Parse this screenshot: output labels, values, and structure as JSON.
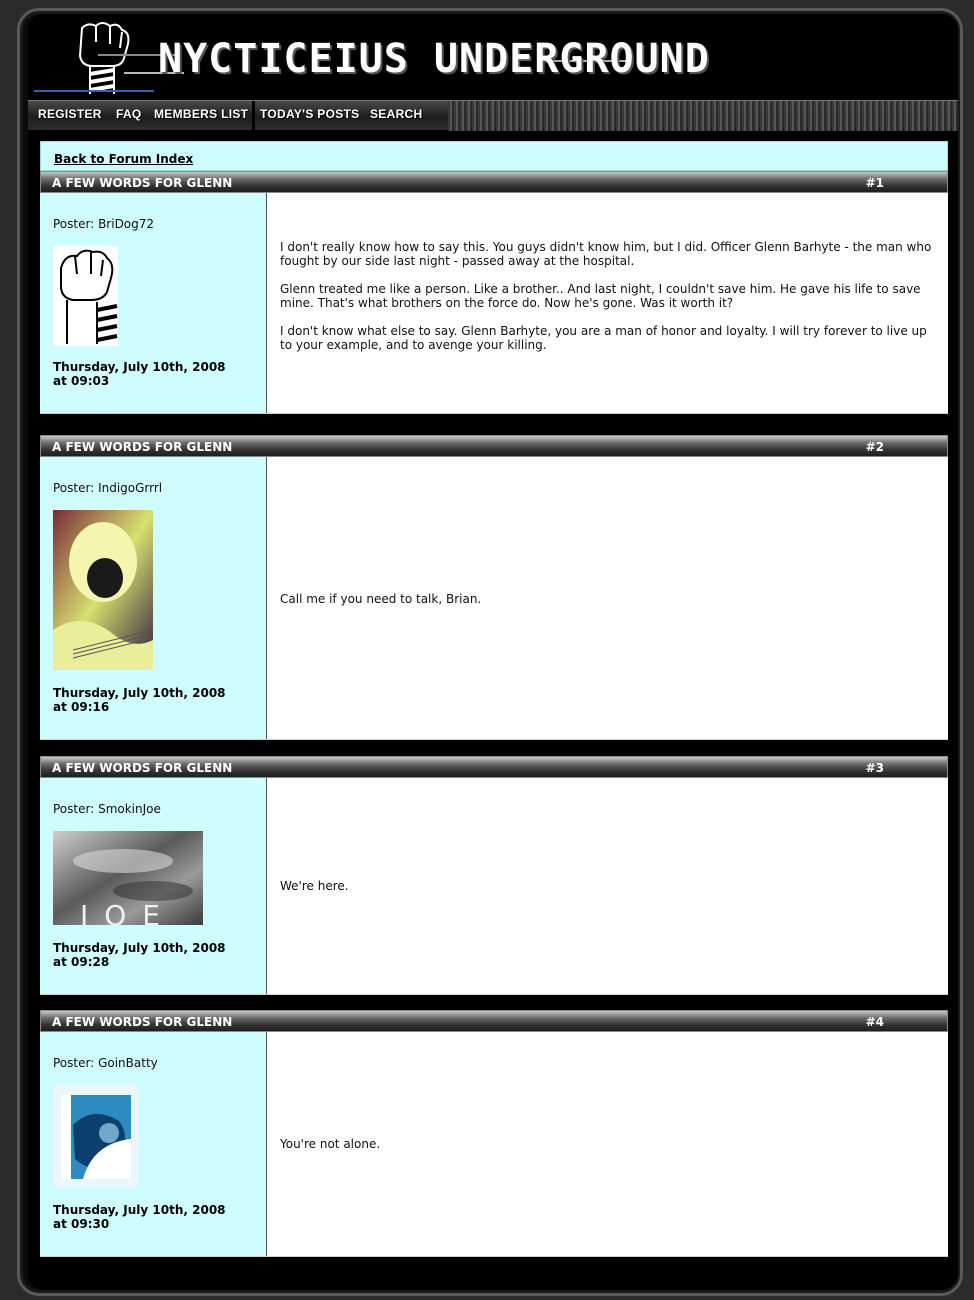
{
  "site": {
    "title": "NYCTICEIUS UNDERGROUND"
  },
  "nav": {
    "items": [
      "REGISTER",
      "FAQ",
      "MEMBERS LIST",
      "TODAY'S POSTS",
      "SEARCH"
    ]
  },
  "back_link": "Back to Forum Index",
  "posts": [
    {
      "subject": "A FEW WORDS FOR GLENN",
      "number": "#1",
      "poster": "Poster: BriDog72",
      "avatar": "fist-icon",
      "date_line1": "Thursday, July 10th, 2008",
      "date_line2": "at 09:03",
      "paragraphs": [
        "I don't really know how to say this. You guys didn't know him, but I did. Officer Glenn Barhyte - the man who fought by our side last night - passed away at the hospital.",
        "Glenn treated me like a person. Like a brother.. And last night, I couldn't save him. He gave his life to save mine. That's what brothers on the force do. Now he's gone. Was it worth it?",
        "I don't know what else to say. Glenn Barhyte, you are a man of honor and loyalty. I will try forever to live up to your example, and to avenge your killing."
      ]
    },
    {
      "subject": "A FEW WORDS FOR GLENN",
      "number": "#2",
      "poster": "Poster: IndigoGrrrl",
      "avatar": "guitar-portrait-avatar",
      "date_line1": "Thursday, July 10th, 2008",
      "date_line2": "at 09:16",
      "paragraphs": [
        "Call me if you need to talk, Brian."
      ]
    },
    {
      "subject": "A FEW WORDS FOR GLENN",
      "number": "#3",
      "poster": "Poster: SmokinJoe",
      "avatar": "smoke-joe-avatar",
      "avatar_text": "JOE",
      "date_line1": "Thursday, July 10th, 2008",
      "date_line2": "at 09:28",
      "paragraphs": [
        "We're here."
      ]
    },
    {
      "subject": "A FEW WORDS FOR GLENN",
      "number": "#4",
      "poster": "Poster: GoinBatty",
      "avatar": "blue-abstract-avatar",
      "date_line1": "Thursday, July 10th, 2008",
      "date_line2": "at 09:30",
      "paragraphs": [
        "You're not alone."
      ]
    }
  ],
  "colors": {
    "poster_bg": "#cffcfc",
    "message_bg": "#ffffff",
    "header_dark": "#1e1e1e",
    "frame_bg": "#000000"
  }
}
